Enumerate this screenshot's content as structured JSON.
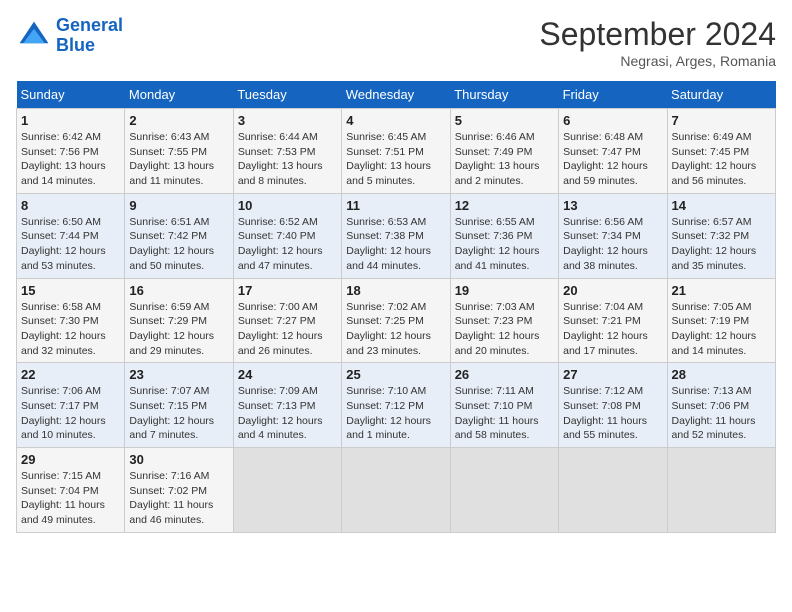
{
  "header": {
    "logo_line1": "General",
    "logo_line2": "Blue",
    "month": "September 2024",
    "location": "Negrasi, Arges, Romania"
  },
  "columns": [
    "Sunday",
    "Monday",
    "Tuesday",
    "Wednesday",
    "Thursday",
    "Friday",
    "Saturday"
  ],
  "weeks": [
    [
      {
        "day": "1",
        "info": "Sunrise: 6:42 AM\nSunset: 7:56 PM\nDaylight: 13 hours\nand 14 minutes."
      },
      {
        "day": "2",
        "info": "Sunrise: 6:43 AM\nSunset: 7:55 PM\nDaylight: 13 hours\nand 11 minutes."
      },
      {
        "day": "3",
        "info": "Sunrise: 6:44 AM\nSunset: 7:53 PM\nDaylight: 13 hours\nand 8 minutes."
      },
      {
        "day": "4",
        "info": "Sunrise: 6:45 AM\nSunset: 7:51 PM\nDaylight: 13 hours\nand 5 minutes."
      },
      {
        "day": "5",
        "info": "Sunrise: 6:46 AM\nSunset: 7:49 PM\nDaylight: 13 hours\nand 2 minutes."
      },
      {
        "day": "6",
        "info": "Sunrise: 6:48 AM\nSunset: 7:47 PM\nDaylight: 12 hours\nand 59 minutes."
      },
      {
        "day": "7",
        "info": "Sunrise: 6:49 AM\nSunset: 7:45 PM\nDaylight: 12 hours\nand 56 minutes."
      }
    ],
    [
      {
        "day": "8",
        "info": "Sunrise: 6:50 AM\nSunset: 7:44 PM\nDaylight: 12 hours\nand 53 minutes."
      },
      {
        "day": "9",
        "info": "Sunrise: 6:51 AM\nSunset: 7:42 PM\nDaylight: 12 hours\nand 50 minutes."
      },
      {
        "day": "10",
        "info": "Sunrise: 6:52 AM\nSunset: 7:40 PM\nDaylight: 12 hours\nand 47 minutes."
      },
      {
        "day": "11",
        "info": "Sunrise: 6:53 AM\nSunset: 7:38 PM\nDaylight: 12 hours\nand 44 minutes."
      },
      {
        "day": "12",
        "info": "Sunrise: 6:55 AM\nSunset: 7:36 PM\nDaylight: 12 hours\nand 41 minutes."
      },
      {
        "day": "13",
        "info": "Sunrise: 6:56 AM\nSunset: 7:34 PM\nDaylight: 12 hours\nand 38 minutes."
      },
      {
        "day": "14",
        "info": "Sunrise: 6:57 AM\nSunset: 7:32 PM\nDaylight: 12 hours\nand 35 minutes."
      }
    ],
    [
      {
        "day": "15",
        "info": "Sunrise: 6:58 AM\nSunset: 7:30 PM\nDaylight: 12 hours\nand 32 minutes."
      },
      {
        "day": "16",
        "info": "Sunrise: 6:59 AM\nSunset: 7:29 PM\nDaylight: 12 hours\nand 29 minutes."
      },
      {
        "day": "17",
        "info": "Sunrise: 7:00 AM\nSunset: 7:27 PM\nDaylight: 12 hours\nand 26 minutes."
      },
      {
        "day": "18",
        "info": "Sunrise: 7:02 AM\nSunset: 7:25 PM\nDaylight: 12 hours\nand 23 minutes."
      },
      {
        "day": "19",
        "info": "Sunrise: 7:03 AM\nSunset: 7:23 PM\nDaylight: 12 hours\nand 20 minutes."
      },
      {
        "day": "20",
        "info": "Sunrise: 7:04 AM\nSunset: 7:21 PM\nDaylight: 12 hours\nand 17 minutes."
      },
      {
        "day": "21",
        "info": "Sunrise: 7:05 AM\nSunset: 7:19 PM\nDaylight: 12 hours\nand 14 minutes."
      }
    ],
    [
      {
        "day": "22",
        "info": "Sunrise: 7:06 AM\nSunset: 7:17 PM\nDaylight: 12 hours\nand 10 minutes."
      },
      {
        "day": "23",
        "info": "Sunrise: 7:07 AM\nSunset: 7:15 PM\nDaylight: 12 hours\nand 7 minutes."
      },
      {
        "day": "24",
        "info": "Sunrise: 7:09 AM\nSunset: 7:13 PM\nDaylight: 12 hours\nand 4 minutes."
      },
      {
        "day": "25",
        "info": "Sunrise: 7:10 AM\nSunset: 7:12 PM\nDaylight: 12 hours\nand 1 minute."
      },
      {
        "day": "26",
        "info": "Sunrise: 7:11 AM\nSunset: 7:10 PM\nDaylight: 11 hours\nand 58 minutes."
      },
      {
        "day": "27",
        "info": "Sunrise: 7:12 AM\nSunset: 7:08 PM\nDaylight: 11 hours\nand 55 minutes."
      },
      {
        "day": "28",
        "info": "Sunrise: 7:13 AM\nSunset: 7:06 PM\nDaylight: 11 hours\nand 52 minutes."
      }
    ],
    [
      {
        "day": "29",
        "info": "Sunrise: 7:15 AM\nSunset: 7:04 PM\nDaylight: 11 hours\nand 49 minutes."
      },
      {
        "day": "30",
        "info": "Sunrise: 7:16 AM\nSunset: 7:02 PM\nDaylight: 11 hours\nand 46 minutes."
      },
      {
        "day": "",
        "info": ""
      },
      {
        "day": "",
        "info": ""
      },
      {
        "day": "",
        "info": ""
      },
      {
        "day": "",
        "info": ""
      },
      {
        "day": "",
        "info": ""
      }
    ]
  ]
}
